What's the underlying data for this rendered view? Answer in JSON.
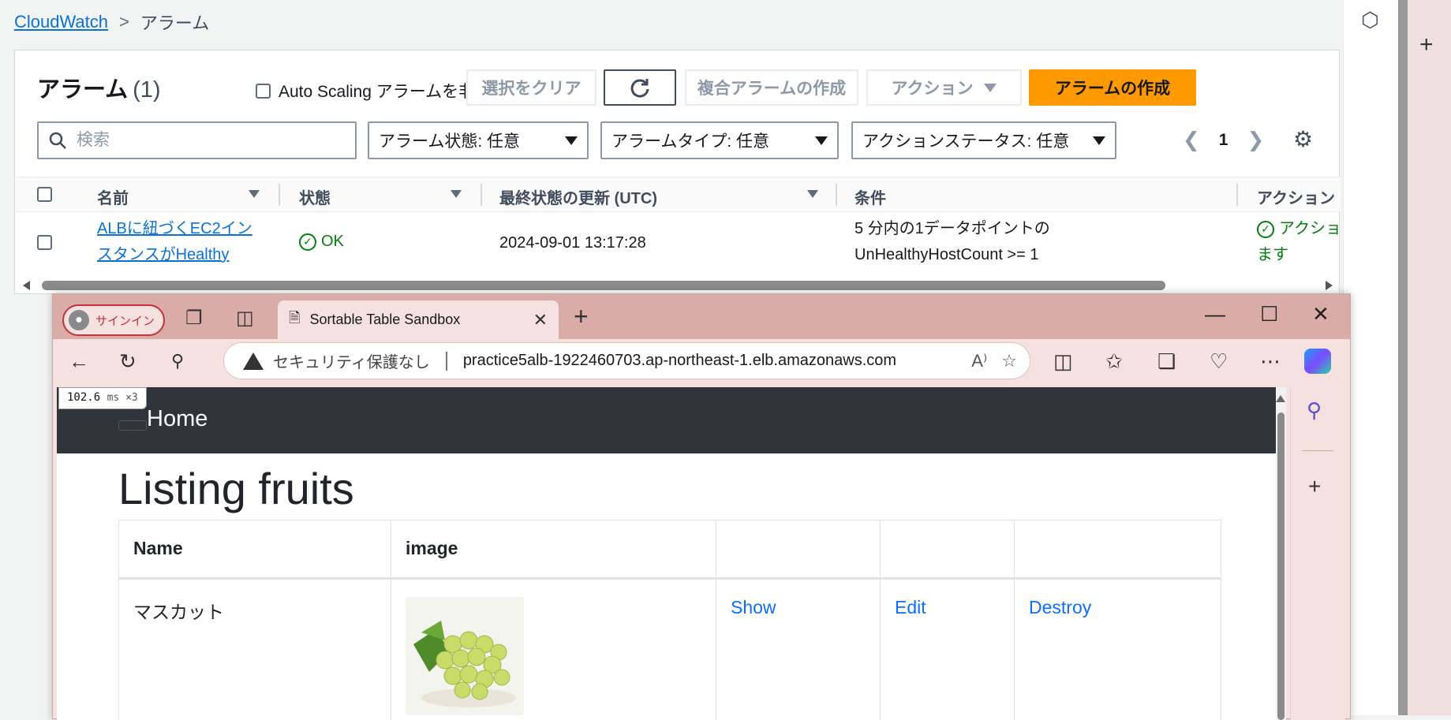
{
  "cloudwatch": {
    "breadcrumb": {
      "root": "CloudWatch",
      "separator": ">",
      "current": "アラーム"
    },
    "panel": {
      "title": "アラーム",
      "count": "(1)",
      "hide_autoscaling_label": "Auto Scaling アラームを非表示",
      "clear_button": "選択をクリア",
      "composite_button": "複合アラームの作成",
      "actions_button": "アクション",
      "create_button": "アラームの作成",
      "search_placeholder": "検索",
      "filters": {
        "state": "アラーム状態: 任意",
        "type": "アラームタイプ: 任意",
        "action_status": "アクションステータス: 任意"
      },
      "page_number": "1"
    },
    "table": {
      "columns": [
        "名前",
        "状態",
        "最終状態の更新 (UTC)",
        "条件",
        "アクション"
      ],
      "rows": [
        {
          "name_line1": "ALBに紐づくEC2イン",
          "name_line2": "スタンスがHealthy",
          "state": "OK",
          "updated": "2024-09-01 13:17:28",
          "condition_line1": "5 分内の1データポイントの",
          "condition_line2": "UnHealthyHostCount >= 1",
          "action_line1": "アクショ",
          "action_line2": "ます"
        }
      ]
    }
  },
  "browser": {
    "signin_label": "サインイン",
    "tab_title": "Sortable Table Sandbox",
    "address": {
      "security_text": "セキュリティ保護なし",
      "url": "practice5alb-1922460703.ap-northeast-1.elb.amazonaws.com"
    }
  },
  "page": {
    "timing": {
      "value": "102.6",
      "unit": "ms ×3"
    },
    "nav_home": "Home",
    "heading": "Listing fruits",
    "table": {
      "headers": [
        "Name",
        "image",
        "",
        "",
        ""
      ],
      "rows": [
        {
          "name": "マスカット",
          "show": "Show",
          "edit": "Edit",
          "destroy": "Destroy"
        }
      ]
    }
  }
}
